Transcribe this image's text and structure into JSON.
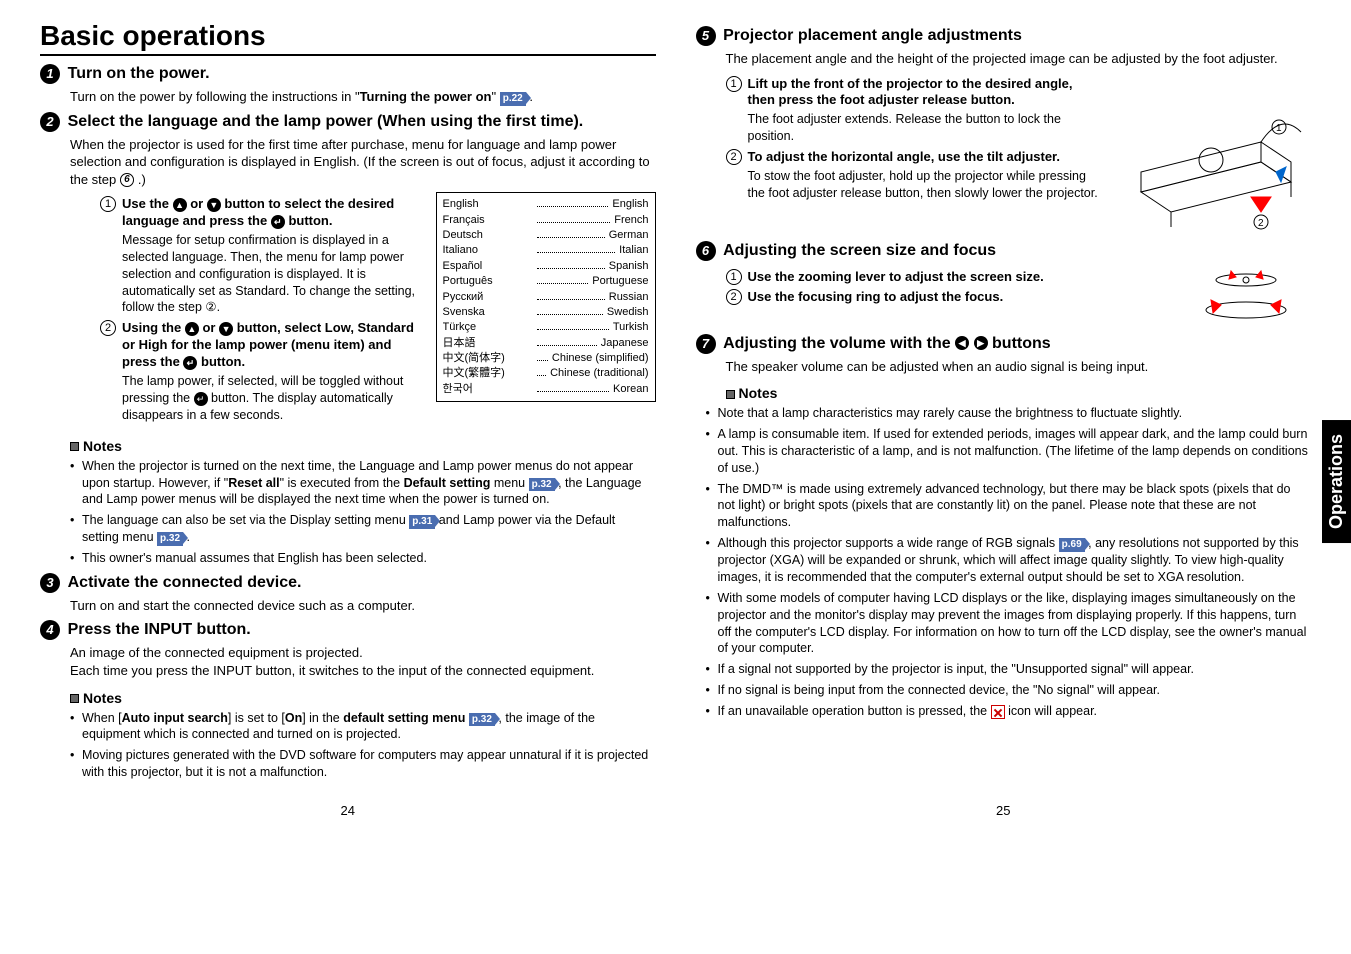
{
  "title": "Basic operations",
  "sidebar_tab": "Operations",
  "page_left_num": "24",
  "page_right_num": "25",
  "left": {
    "step1": {
      "title": "Turn on the power.",
      "body_a": "Turn on the power by following the instructions in \"",
      "body_b": "Turning the power on",
      "body_c": "\" ",
      "ref": "p.22",
      "body_d": " ."
    },
    "step2": {
      "title": "Select the language and the lamp power (When using the first time).",
      "intro": "When the projector is used for the first time after purchase, menu for language and lamp power selection and configuration is displayed in English. (If the screen is out of focus, adjust it according to the step ",
      "intro_ref": "6",
      "intro_end": ".)",
      "sub1_title": "Use the ⬆ or ⬇ button to select the desired language and press the ⏎ button.",
      "sub1_body": "Message for setup confirmation is displayed in a selected language.\nThen, the menu for lamp power selection and configuration is displayed. It is automatically set as Standard. To change the setting, follow the step ②.",
      "sub2_title": "Using the ⬆ or ⬇ button, select Low, Standard or High for the lamp power (menu item) and press the ⏎ button.",
      "sub2_body": "The lamp power, if selected, will be toggled without pressing the ⏎ button. The display automatically disappears in a few seconds.",
      "languages": [
        {
          "native": "English",
          "eng": "English"
        },
        {
          "native": "Français",
          "eng": "French"
        },
        {
          "native": "Deutsch",
          "eng": "German"
        },
        {
          "native": "Italiano",
          "eng": "Italian"
        },
        {
          "native": "Español",
          "eng": "Spanish"
        },
        {
          "native": "Português",
          "eng": "Portuguese"
        },
        {
          "native": "Русский",
          "eng": "Russian"
        },
        {
          "native": "Svenska",
          "eng": "Swedish"
        },
        {
          "native": "Türkçe",
          "eng": "Turkish"
        },
        {
          "native": "日本語",
          "eng": "Japanese"
        },
        {
          "native": "中文(简体字)",
          "eng": "Chinese (simplified)"
        },
        {
          "native": "中文(繁體字)",
          "eng": "Chinese (traditional)"
        },
        {
          "native": "한국어",
          "eng": "Korean"
        }
      ]
    },
    "notes1_hd": "Notes",
    "notes1": [
      "When the projector is turned on the next time, the Language and Lamp power menus do not appear upon startup. However, if \"Reset all\" is executed from the Default setting menu p.32 , the Language and Lamp power menus will be displayed the next time when the power is turned on.",
      "The language can also be set via the Display setting menu p.31 and Lamp power via the Default setting menu p.32 .",
      "This owner's manual assumes that English has been selected."
    ],
    "notes1_refs": {
      "a": "p.32",
      "b": "p.31",
      "c": "p.32"
    },
    "step3": {
      "title": "Activate the connected device.",
      "body": "Turn on and start the connected device such as a computer."
    },
    "step4": {
      "title": "Press the INPUT button.",
      "body": "An image of the connected equipment is projected.\nEach time you press the INPUT button, it switches to the input of the connected equipment."
    },
    "notes2_hd": "Notes",
    "notes2": {
      "a_pre": "When [",
      "a_b1": "Auto input search",
      "a_mid": "] is set to [",
      "a_b2": "On",
      "a_mid2": "] in the ",
      "a_b3": "default setting menu",
      "a_ref": "p.32",
      "a_post": " , the image of the equipment which is connected and turned on is projected.",
      "b": "Moving pictures generated with the DVD software for computers may appear unnatural if it is projected with this projector, but it is not a malfunction."
    }
  },
  "right": {
    "step5": {
      "title": "Projector placement angle adjustments",
      "body": "The placement angle and the height of the projected image can be adjusted by the foot adjuster.",
      "sub1_title": "Lift up the front of the projector to the desired angle, then press the foot adjuster release button.",
      "sub1_body": "The foot adjuster extends. Release the button to lock the position.",
      "sub2_title": "To adjust the horizontal angle, use the tilt adjuster.",
      "sub2_body": "To stow the foot adjuster, hold up the projector while pressing the foot adjuster release button, then slowly lower the projector."
    },
    "step6": {
      "title": "Adjusting the screen size and focus",
      "sub1": "Use the zooming lever to adjust the screen size.",
      "sub2": "Use the focusing ring to adjust the focus."
    },
    "step7": {
      "title_a": "Adjusting the volume with the ",
      "title_b": " buttons",
      "body": "The speaker volume can be adjusted when an audio signal is being input."
    },
    "notes_hd": "Notes",
    "notes": {
      "n1": "Note that a lamp characteristics may rarely cause the brightness to fluctuate slightly.",
      "n2": "A lamp is consumable item. If used for extended periods, images will appear dark, and the lamp could burn out.  This is characteristic of a lamp, and is not malfunction. (The lifetime of the lamp depends on conditions of use.)",
      "n3": "The DMD™ is made using extremely advanced technology, but there may be black spots (pixels that do not light) or bright spots (pixels that are constantly lit) on the panel.  Please note that these are not malfunctions.",
      "n4_pre": "Although this projector supports a wide range of RGB signals ",
      "n4_ref": "p.69",
      "n4_post": " , any resolutions not supported by this projector (XGA) will be expanded or shrunk, which will affect image quality slightly. To view high-quality images, it is recommended that the computer's external output should be set to XGA resolution.",
      "n5": "With some models of computer having LCD displays or the like, displaying images simultaneously on the projector and the monitor's display may prevent the images from displaying properly. If this happens, turn off the computer's LCD display. For information on how to turn off the LCD display, see the owner's manual of your computer.",
      "n6": "If a signal not supported by the projector is input, the \"Unsupported signal\" will appear.",
      "n7": "If no signal is being input from the connected device, the \"No signal\" will appear.",
      "n8_pre": "If an unavailable operation button is pressed, the ",
      "n8_post": " icon will appear."
    }
  }
}
